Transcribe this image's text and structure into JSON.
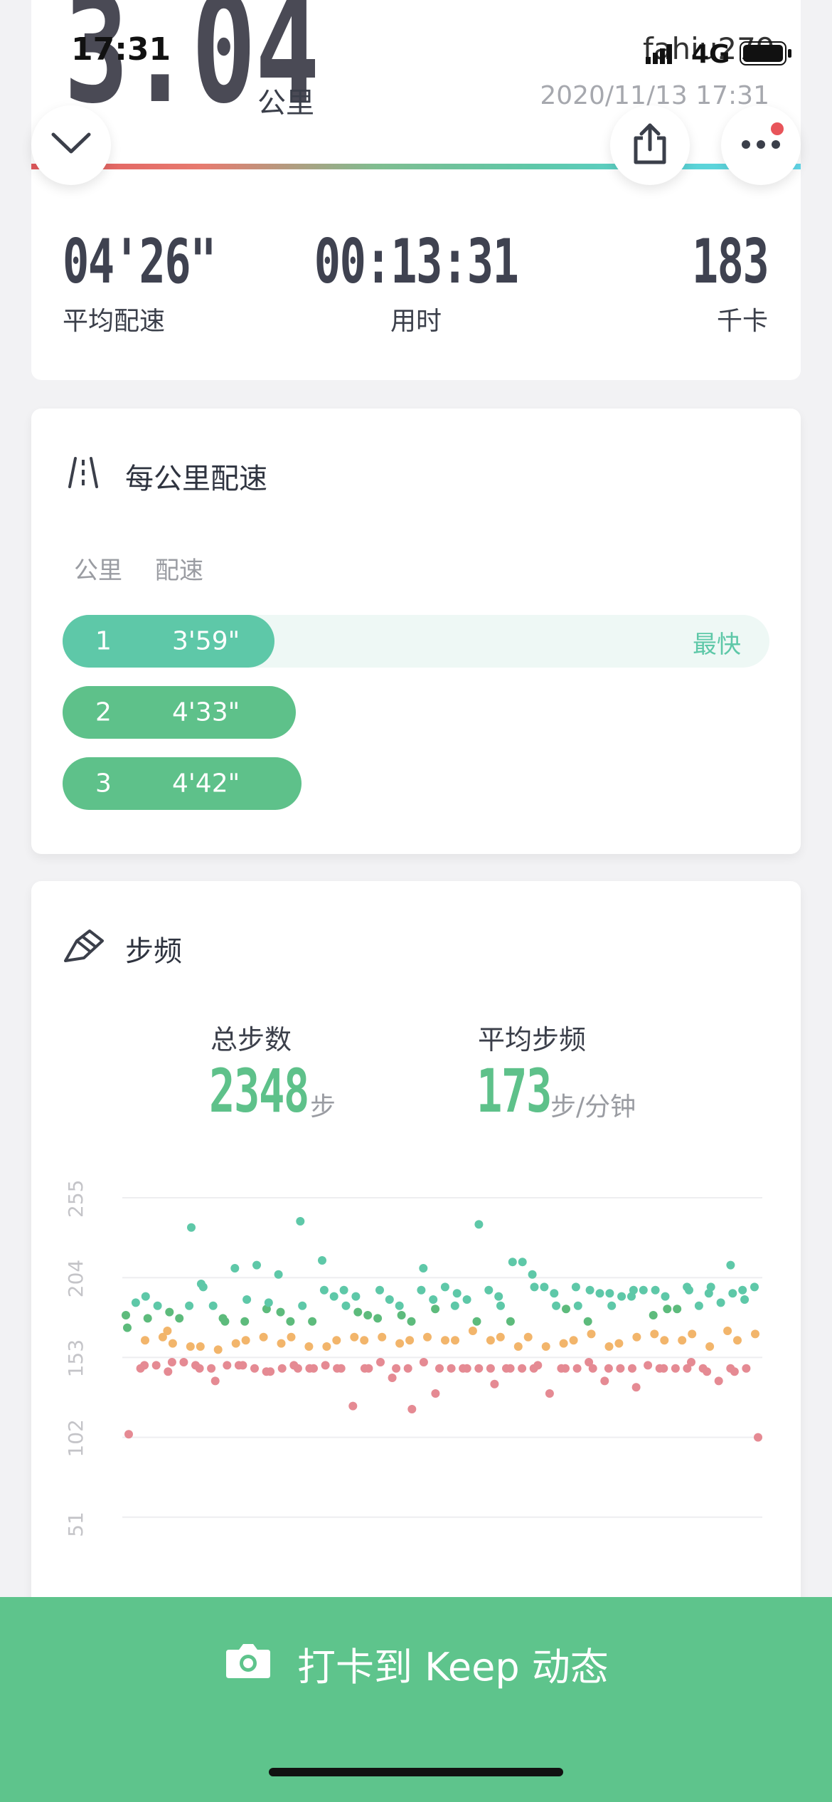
{
  "status_bar": {
    "time": "17:31",
    "carrier_overlay": "fahiu279",
    "network": "4G"
  },
  "header": {
    "distance_value": "3.04",
    "distance_unit": "公里",
    "datetime": "2020/11/13 17:31"
  },
  "stats": [
    {
      "value": "04'26\"",
      "label": "平均配速"
    },
    {
      "value": "00:13:31",
      "label": "用时"
    },
    {
      "value": "183",
      "label": "千卡"
    }
  ],
  "pace_section": {
    "title": "每公里配速",
    "col_km": "公里",
    "col_pace": "配速",
    "fastest_label": "最快",
    "rows": [
      {
        "km": "1",
        "pace": "3'59\"",
        "fastest": true
      },
      {
        "km": "2",
        "pace": "4'33\"",
        "fastest": false
      },
      {
        "km": "3",
        "pace": "4'42\"",
        "fastest": false
      }
    ]
  },
  "cadence_section": {
    "title": "步频",
    "total_steps_label": "总步数",
    "total_steps_value": "2348",
    "total_steps_unit": "步",
    "avg_cadence_label": "平均步频",
    "avg_cadence_value": "173",
    "avg_cadence_unit": "步/分钟"
  },
  "chart_data": {
    "type": "scatter",
    "title": "",
    "xlabel": "",
    "ylabel": "",
    "ylim": [
      0,
      255
    ],
    "yticks": [
      "255",
      "204",
      "153",
      "102",
      "51",
      "0"
    ],
    "grid": true,
    "colors": {
      "high": "#5ec8a8",
      "mid": "#f2b56b",
      "low": "#e58a93",
      "mid_green": "#5dbb7c"
    },
    "series": [
      {
        "values": [
          180,
          188,
          192,
          178,
          186,
          170,
          182,
          178,
          186,
          236,
          200,
          198,
          186,
          178,
          176,
          210,
          176,
          190,
          212,
          184,
          188,
          206,
          182,
          176,
          240,
          186,
          176,
          215,
          196,
          192,
          196,
          186,
          192,
          182,
          180,
          178,
          196,
          190,
          186,
          180,
          176,
          196,
          210,
          190,
          184,
          198,
          186,
          194,
          190,
          176,
          238,
          196,
          192,
          186,
          176,
          214,
          214,
          206,
          198,
          198,
          194,
          186,
          184,
          198,
          186,
          176,
          196,
          194,
          194,
          186,
          192,
          192,
          196,
          196,
          180,
          196,
          192,
          184,
          184,
          198,
          196,
          186,
          194,
          198,
          188,
          212,
          194,
          196,
          190,
          198
        ]
      },
      {
        "values": [
          172,
          164,
          166,
          162,
          160,
          160,
          158,
          162,
          164,
          166,
          162,
          166,
          160,
          160,
          164,
          166,
          164,
          166,
          162,
          164,
          166,
          164,
          164,
          170,
          164,
          166,
          160,
          166,
          160,
          162,
          164,
          168,
          160,
          162,
          166,
          168,
          164,
          164,
          168,
          160,
          170,
          164,
          168
        ]
      },
      {
        "values": [
          104,
          146,
          148,
          148,
          144,
          150,
          150,
          148,
          146,
          146,
          138,
          148,
          148,
          148,
          146,
          144,
          144,
          146,
          148,
          146,
          146,
          146,
          148,
          146,
          146,
          122,
          146,
          146,
          150,
          140,
          146,
          146,
          120,
          150,
          130,
          146,
          146,
          146,
          146,
          146,
          146,
          136,
          146,
          146,
          146,
          146,
          148,
          130,
          146,
          146,
          146,
          150,
          146,
          138,
          146,
          146,
          146,
          134,
          148,
          146,
          146,
          146,
          146,
          150,
          146,
          144,
          138,
          146,
          144,
          146,
          102
        ]
      }
    ]
  },
  "footer": {
    "checkin_label": "打卡到 Keep 动态"
  }
}
